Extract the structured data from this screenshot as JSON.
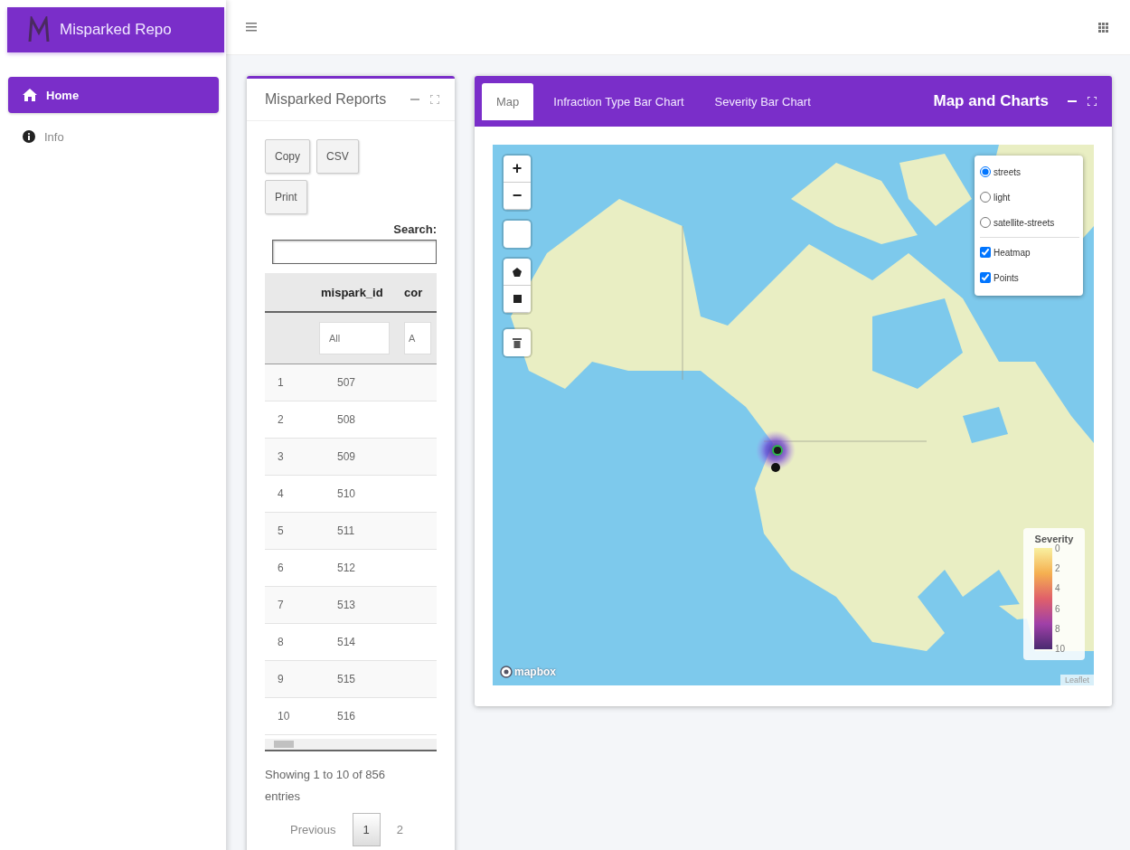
{
  "brand": {
    "title": "Misparked Repo"
  },
  "nav": [
    {
      "label": "Home",
      "kind": "home",
      "selected": true
    },
    {
      "label": "Info",
      "kind": "info",
      "selected": false
    }
  ],
  "reports_card": {
    "title": "Misparked Reports",
    "buttons": [
      "Copy",
      "CSV",
      "Print"
    ],
    "search_label": "Search:",
    "columns": [
      "",
      "mispark_id",
      "cor"
    ],
    "filters": [
      {
        "placeholder": "All"
      },
      {
        "placeholder": "A"
      }
    ],
    "rows": [
      [
        "1",
        "507"
      ],
      [
        "2",
        "508"
      ],
      [
        "3",
        "509"
      ],
      [
        "4",
        "510"
      ],
      [
        "5",
        "511"
      ],
      [
        "6",
        "512"
      ],
      [
        "7",
        "513"
      ],
      [
        "8",
        "514"
      ],
      [
        "9",
        "515"
      ],
      [
        "10",
        "516"
      ]
    ],
    "info": "Showing 1 to 10 of 856 entries",
    "pagination": {
      "previous": "Previous",
      "pages": [
        {
          "label": "1",
          "selected": true
        },
        {
          "label": "2",
          "selected": false
        }
      ]
    }
  },
  "map_card": {
    "title": "Map and Charts",
    "tabs": [
      {
        "label": "Map",
        "selected": true
      },
      {
        "label": "Infraction Type Bar Chart",
        "selected": false
      },
      {
        "label": "Severity Bar Chart",
        "selected": false
      }
    ],
    "zoom_in": "+",
    "zoom_out": "−",
    "base_layers": [
      {
        "label": "streets",
        "selected": true
      },
      {
        "label": "light",
        "selected": false
      },
      {
        "label": "satellite-streets",
        "selected": false
      }
    ],
    "overlays": [
      {
        "label": "Heatmap",
        "checked": true
      },
      {
        "label": "Points",
        "checked": true
      }
    ],
    "legend": {
      "title": "Severity",
      "ticks": [
        "0",
        "2",
        "4",
        "6",
        "8",
        "10"
      ]
    },
    "logo_text": "mapbox",
    "attribution": "Leaflet"
  }
}
